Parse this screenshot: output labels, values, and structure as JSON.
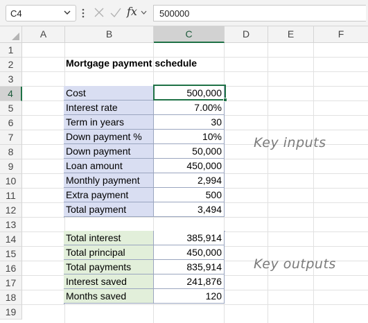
{
  "formula_bar": {
    "name_box": "C4",
    "fx_label": "fx",
    "formula": "500000"
  },
  "columns": [
    "A",
    "B",
    "C",
    "D",
    "E",
    "F"
  ],
  "rows": [
    "1",
    "2",
    "3",
    "4",
    "5",
    "6",
    "7",
    "8",
    "9",
    "10",
    "11",
    "12",
    "13",
    "14",
    "15",
    "16",
    "17",
    "18",
    "19"
  ],
  "title": "Mortgage payment schedule",
  "inputs": [
    {
      "label": "Cost",
      "value": "500,000"
    },
    {
      "label": "Interest rate",
      "value": "7.00%"
    },
    {
      "label": "Term in years",
      "value": "30"
    },
    {
      "label": "Down payment %",
      "value": "10%"
    },
    {
      "label": "Down payment",
      "value": "50,000"
    },
    {
      "label": "Loan amount",
      "value": "450,000"
    },
    {
      "label": "Monthly payment",
      "value": "2,994"
    },
    {
      "label": "Extra payment",
      "value": "500"
    },
    {
      "label": "Total payment",
      "value": "3,494"
    }
  ],
  "outputs": [
    {
      "label": "Total interest",
      "value": "385,914"
    },
    {
      "label": "Total principal",
      "value": "450,000"
    },
    {
      "label": "Total payments",
      "value": "835,914"
    },
    {
      "label": "Interest saved",
      "value": "241,876"
    },
    {
      "label": "Months saved",
      "value": "120"
    }
  ],
  "notes": {
    "inputs": "Key inputs",
    "outputs": "Key outputs"
  },
  "colors": {
    "accent": "#1e7145",
    "input_fill": "#d9def2",
    "output_fill": "#e2efda"
  },
  "icons": [
    "chevron-down-icon",
    "more-options-icon",
    "cancel-x-icon",
    "confirm-check-icon",
    "insert-function-icon"
  ]
}
